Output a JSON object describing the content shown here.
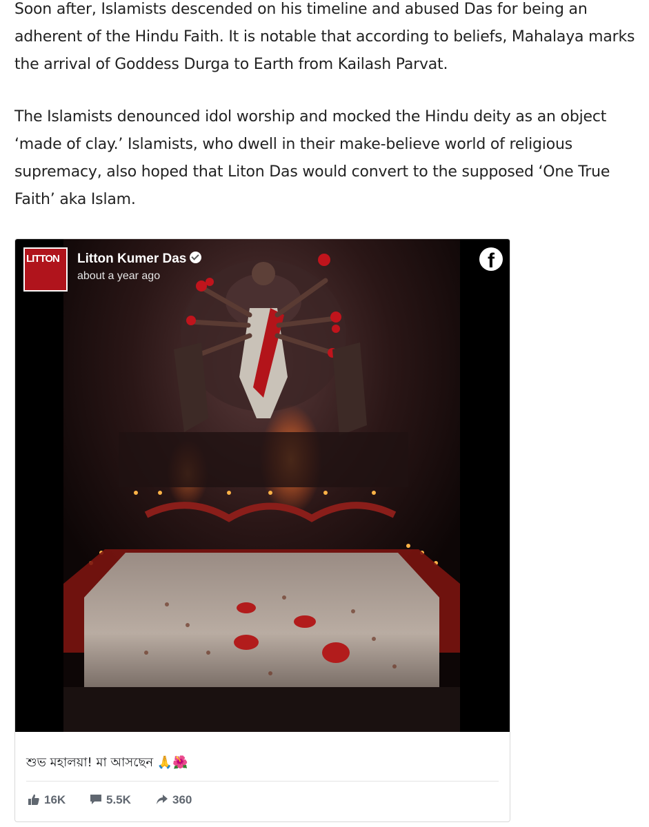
{
  "article": {
    "paragraph1": "Soon after, Islamists descended on his timeline and abused Das for being an adherent of the Hindu Faith. It is notable that according to beliefs, Mahalaya marks the arrival of Goddess Durga to Earth from Kailash Parvat.",
    "paragraph2": "The Islamists denounced idol worship and mocked the Hindu deity as an object ‘made of clay.’ Islamists, who dwell in their make-believe world of religious supremacy, also hoped that Liton Das would convert to the supposed ‘One True Faith’ aka Islam."
  },
  "embed": {
    "avatar_text": "LITTON",
    "author": "Litton Kumer Das",
    "timestamp": "about a year ago",
    "platform_icon": "facebook-icon",
    "caption": "শুভ মহালয়া! মা আসছেন 🙏🌺",
    "stats": {
      "likes": "16K",
      "comments": "5.5K",
      "shares": "360"
    },
    "colors": {
      "background": "#000000",
      "stat_text": "#606770",
      "avatar_bg": "#b0141c"
    }
  }
}
